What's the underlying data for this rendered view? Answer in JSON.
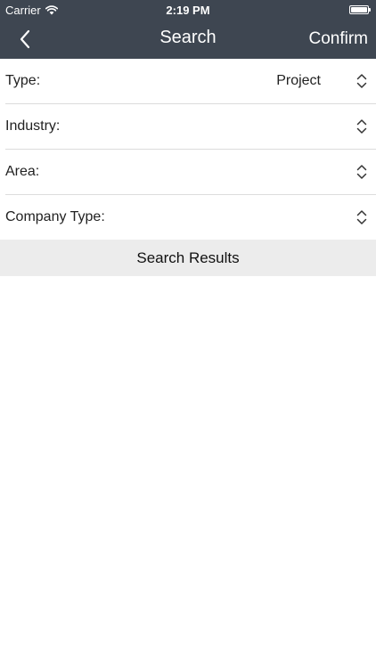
{
  "status_bar": {
    "carrier": "Carrier",
    "time": "2:19 PM",
    "battery_level": 1.0
  },
  "nav": {
    "title": "Search",
    "confirm_label": "Confirm",
    "back_icon": "chevron-left-icon"
  },
  "form": {
    "rows": [
      {
        "label": "Type:",
        "value": "Project",
        "icon": "up-down-chevron-icon"
      },
      {
        "label": "Industry:",
        "value": "",
        "icon": "up-down-chevron-icon"
      },
      {
        "label": "Area:",
        "value": "",
        "icon": "up-down-chevron-icon"
      },
      {
        "label": "Company Type:",
        "value": "",
        "icon": "up-down-chevron-icon"
      }
    ]
  },
  "search_button": {
    "label": "Search Results"
  },
  "colors": {
    "nav_background": "#3e4651",
    "nav_text": "#ffffff",
    "button_background": "#ececec",
    "separator": "#dcdcdc"
  }
}
